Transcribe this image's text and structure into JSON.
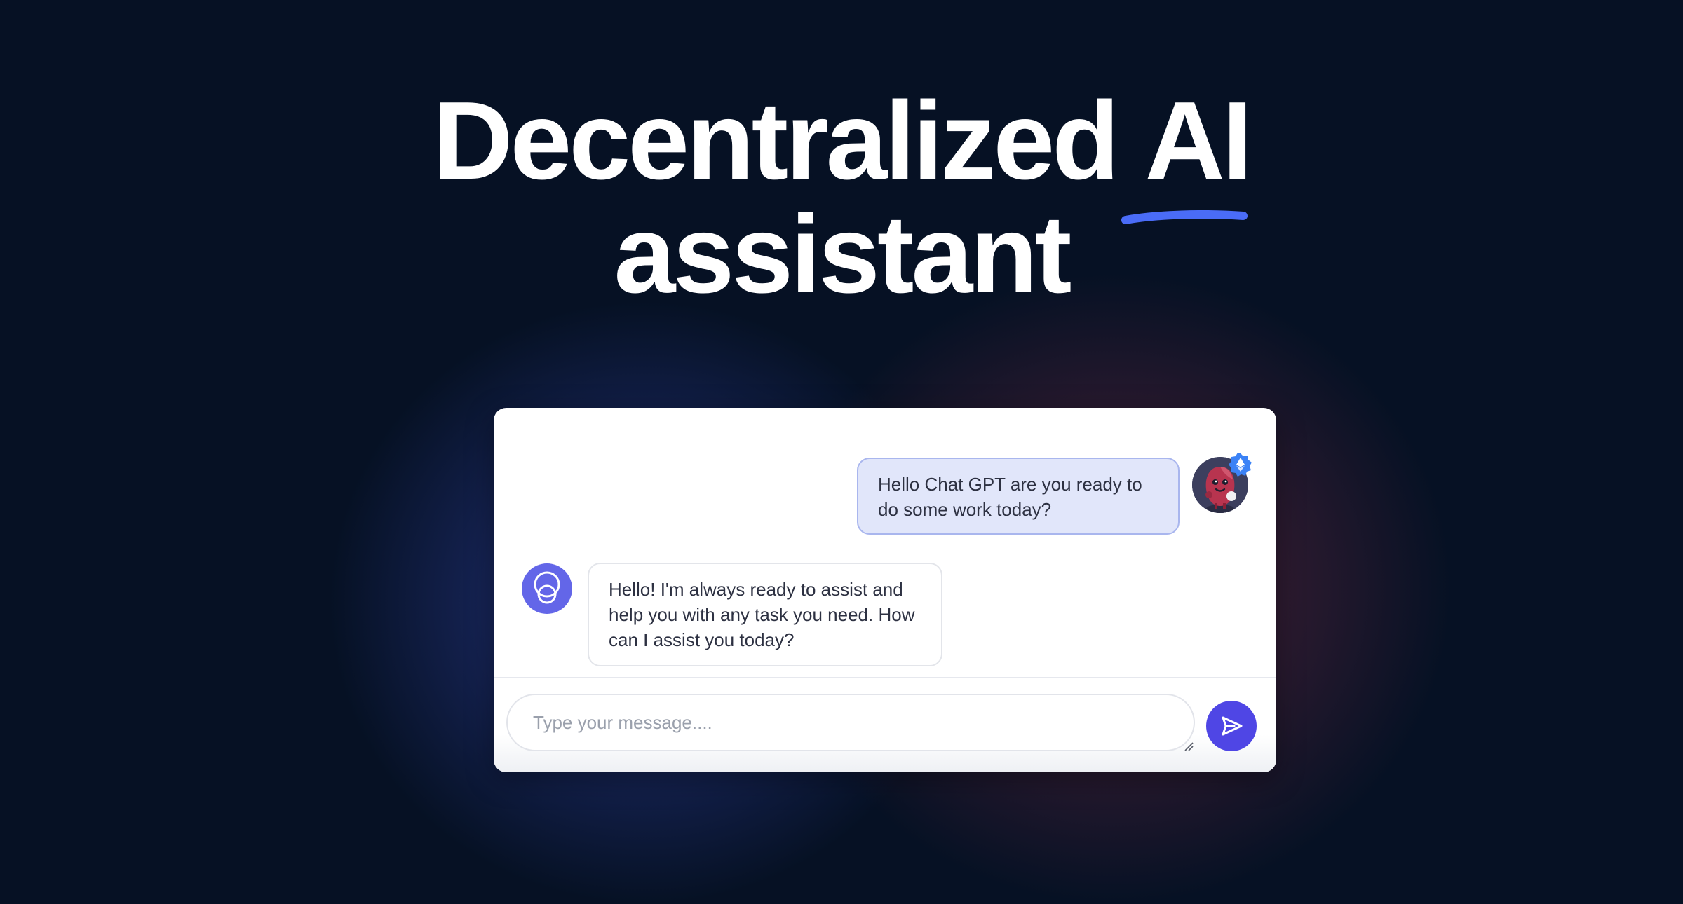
{
  "hero": {
    "title_part1": "Decentralized",
    "title_highlight": "AI",
    "title_line2": "assistant",
    "accent_color": "#4a6cf7"
  },
  "chat": {
    "messages": [
      {
        "role": "user",
        "text": "Hello Chat GPT are you ready to do some work today?",
        "avatar_icon": "user-mascot-avatar",
        "badge_icon": "ethereum-verified-badge-icon"
      },
      {
        "role": "assistant",
        "text": "Hello! I'm always ready to assist and help you with any task you need. How can I assist you today?",
        "avatar_icon": "assistant-logo-icon"
      }
    ],
    "input": {
      "placeholder": "Type your message....",
      "value": ""
    },
    "send_icon": "paper-plane-icon",
    "colors": {
      "user_bubble": "#e1e6fa",
      "user_bubble_border": "#a9b6ee",
      "bot_avatar": "#6366e8",
      "send_button": "#4f46e5"
    }
  }
}
